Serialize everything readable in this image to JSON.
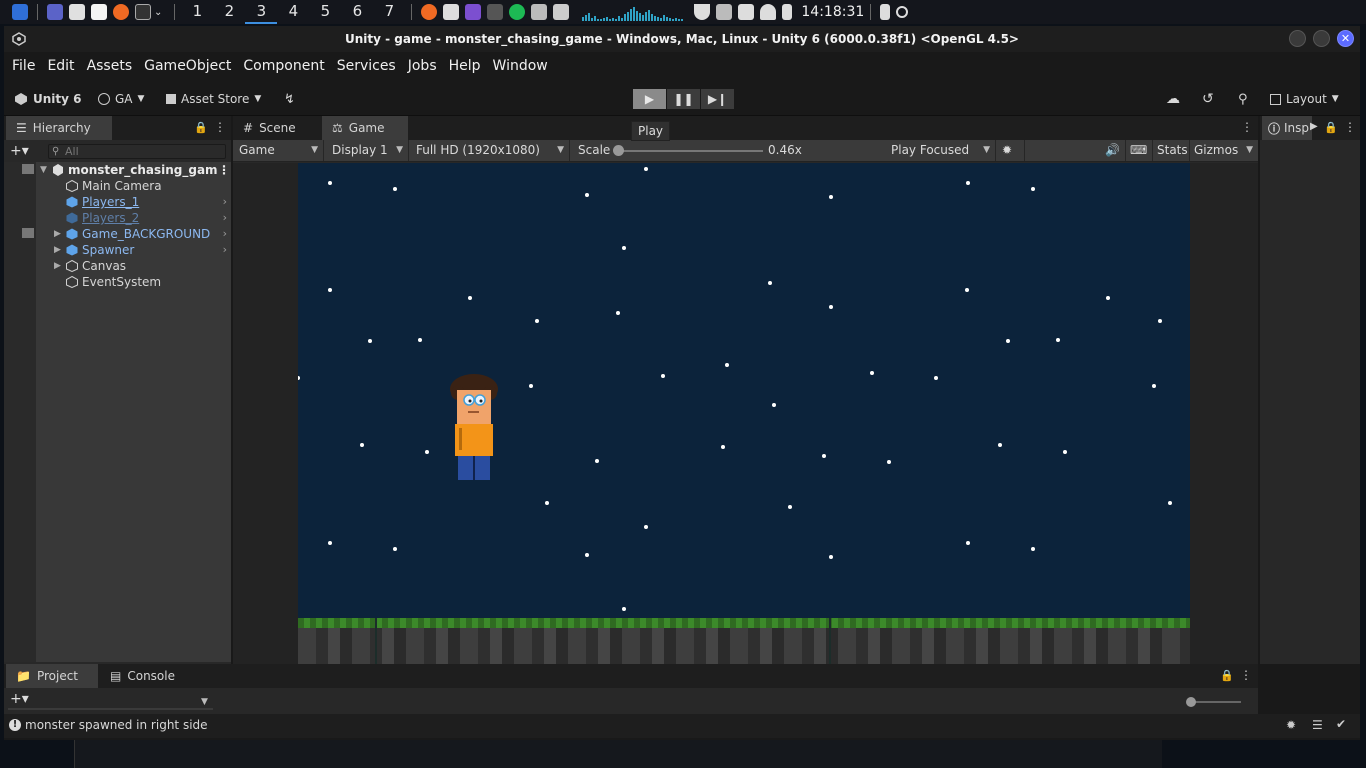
{
  "taskbar": {
    "workspaces": [
      "1",
      "2",
      "3",
      "4",
      "5",
      "6",
      "7"
    ],
    "active_workspace": "3",
    "clock": "14:18:31"
  },
  "window": {
    "title": "Unity - game - monster_chasing_game - Windows, Mac, Linux - Unity 6 (6000.0.38f1) <OpenGL 4.5>"
  },
  "menubar": [
    "File",
    "Edit",
    "Assets",
    "GameObject",
    "Component",
    "Services",
    "Jobs",
    "Help",
    "Window"
  ],
  "toolbar": {
    "unity_label": "Unity 6",
    "account_label": "GA",
    "asset_store_label": "Asset Store",
    "layout_label": "Layout",
    "play_tooltip": "Play"
  },
  "hierarchy": {
    "tab_label": "Hierarchy",
    "search_placeholder": "All",
    "scene_name": "monster_chasing_gam",
    "items": [
      {
        "label": "Main Camera",
        "type": "gameobject"
      },
      {
        "label": "Players_1",
        "type": "prefab"
      },
      {
        "label": "Players_2",
        "type": "prefab-disabled"
      },
      {
        "label": "Game_BACKGROUND",
        "type": "prefab"
      },
      {
        "label": "Spawner",
        "type": "prefab"
      },
      {
        "label": "Canvas",
        "type": "gameobject"
      },
      {
        "label": "EventSystem",
        "type": "gameobject"
      }
    ]
  },
  "game_view": {
    "tab_scene": "Scene",
    "tab_game": "Game",
    "mode": "Game",
    "display": "Display 1",
    "resolution": "Full HD (1920x1080)",
    "scale_label": "Scale",
    "scale_value": "0.46x",
    "play_focus": "Play Focused",
    "stats_label": "Stats",
    "gizmos_label": "Gizmos"
  },
  "inspector": {
    "tab_label": "Insp"
  },
  "bottom": {
    "tab_project": "Project",
    "tab_console": "Console"
  },
  "status": {
    "message": "monster spawned in right side"
  },
  "colors": {
    "sky": "#0c233b",
    "prefab_blue": "#8cb8f0",
    "player_shirt": "#f39418",
    "player_pants": "#2a4da0"
  }
}
